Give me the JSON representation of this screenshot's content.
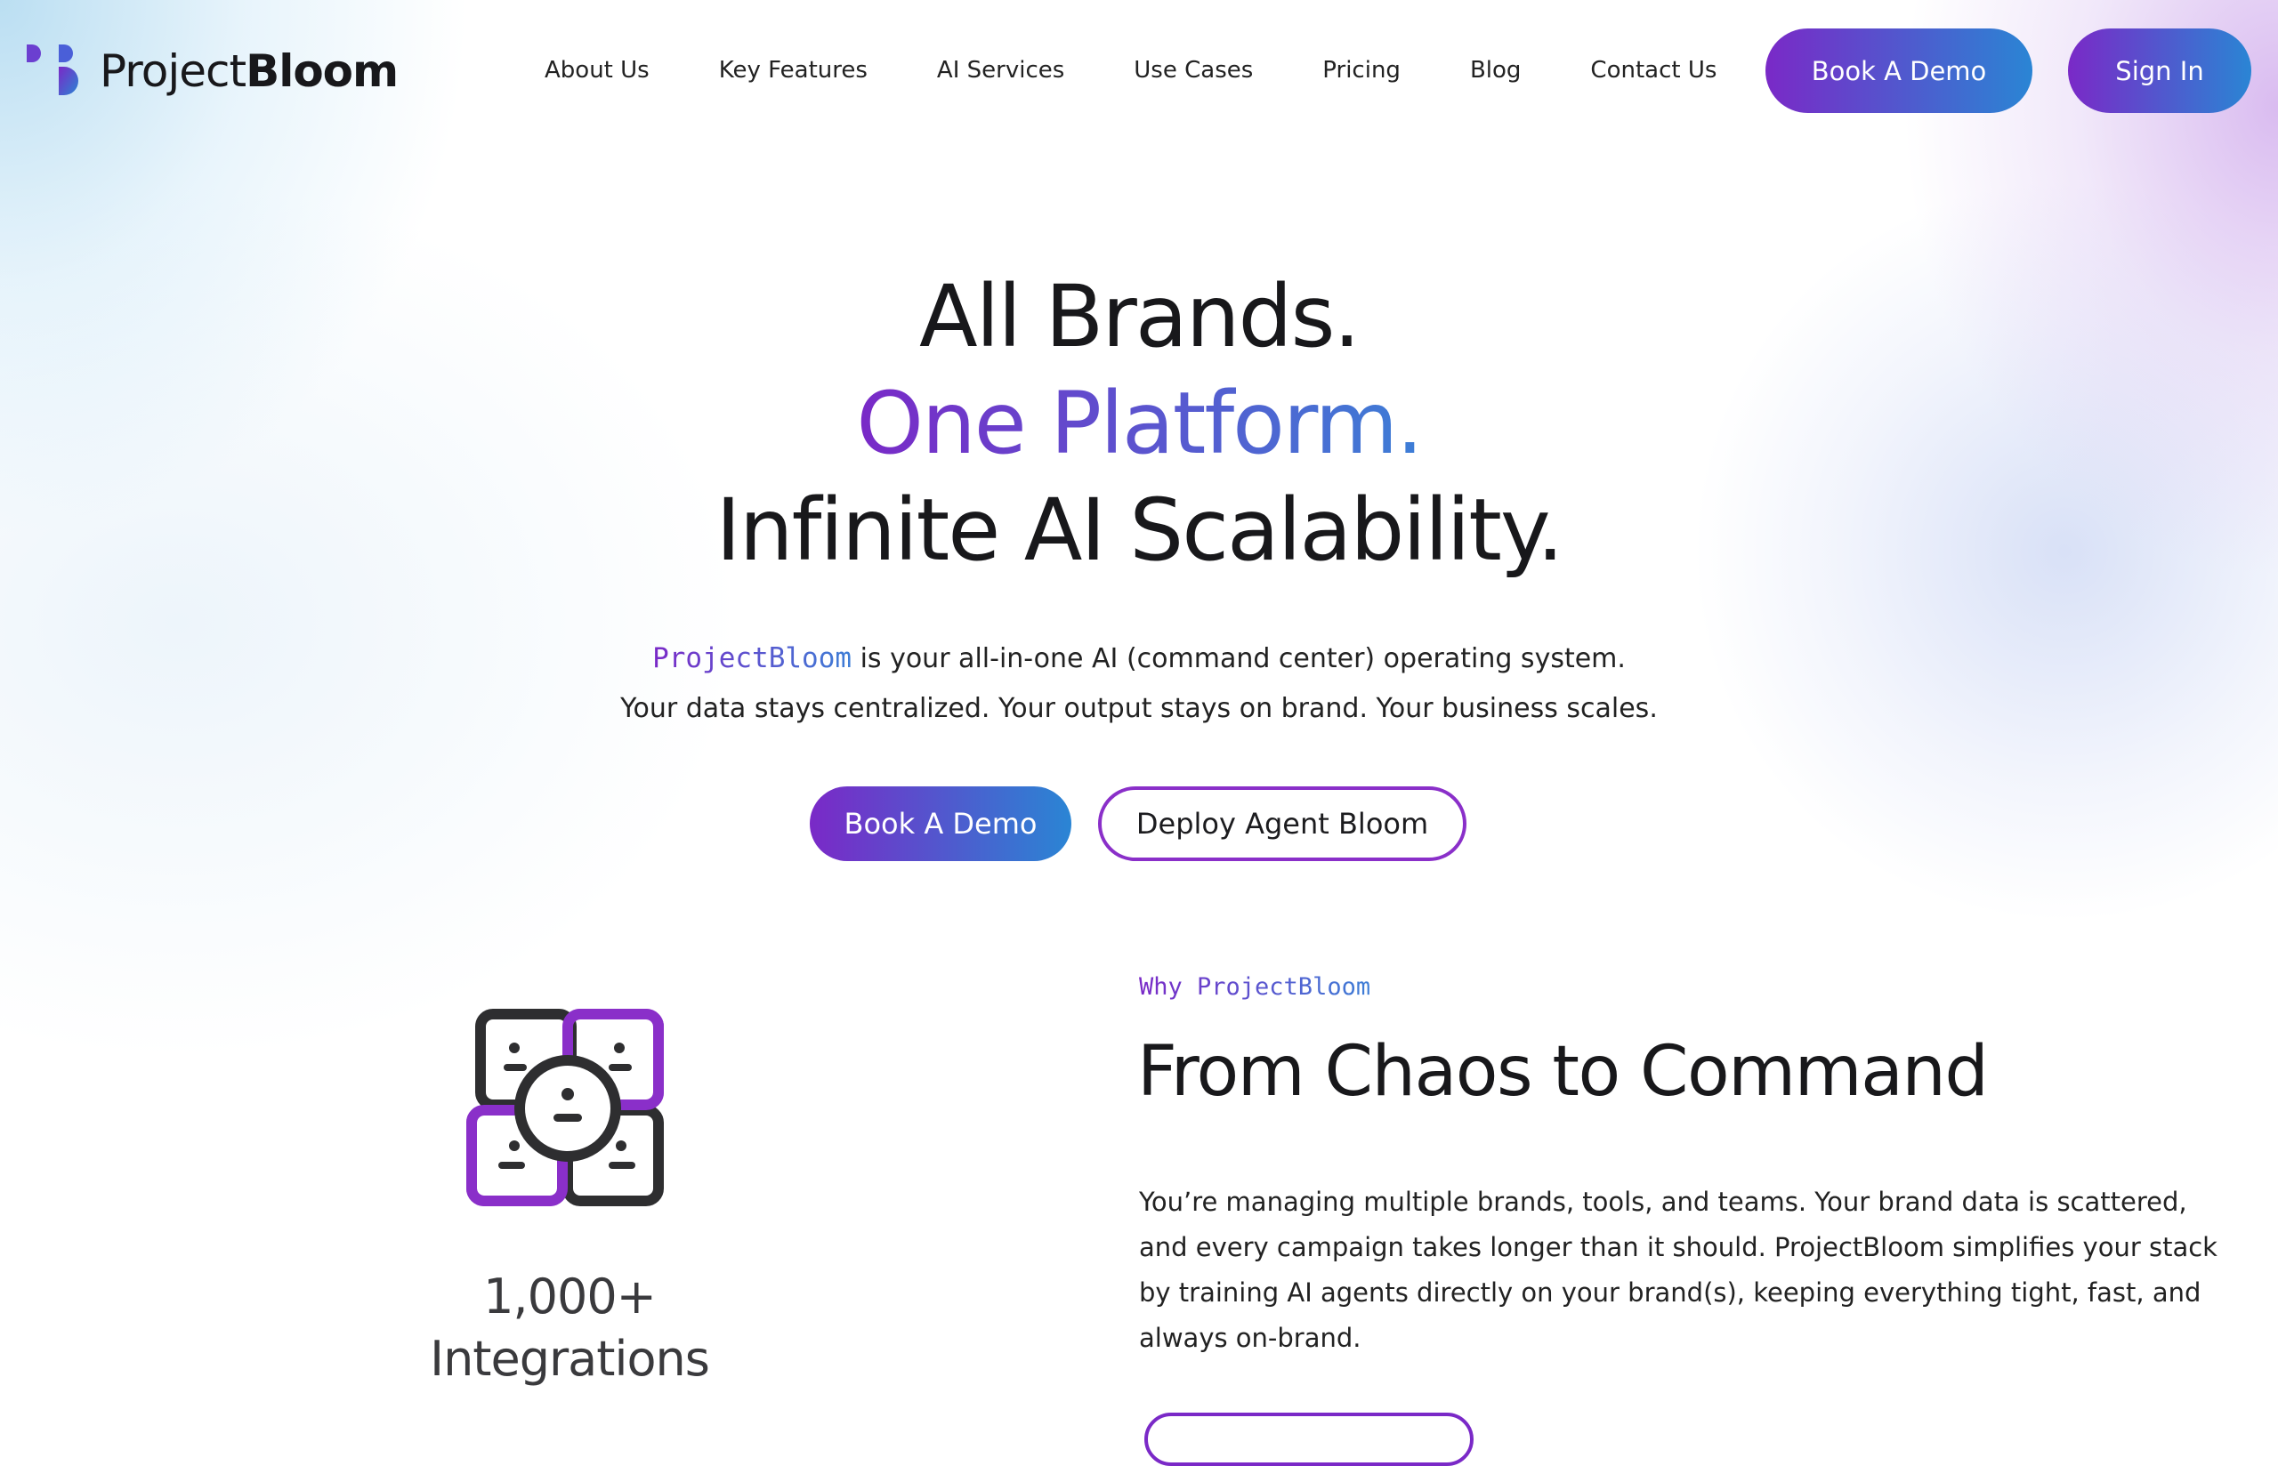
{
  "brand": {
    "name_light": "Project",
    "name_bold": "Bloom",
    "logo_icon": "bloom-logo-icon",
    "colors": {
      "gradient_start": "#7a29c7",
      "gradient_end": "#2a85d4",
      "text": "#18181b"
    }
  },
  "nav": {
    "links": [
      "About Us",
      "Key Features",
      "AI Services",
      "Use Cases",
      "Pricing",
      "Blog",
      "Contact Us"
    ],
    "book_demo": "Book A Demo",
    "sign_in": "Sign In"
  },
  "hero": {
    "line1": "All Brands.",
    "line2": "One Platform.",
    "line3": "Infinite AI Scalability.",
    "brand_mono": "ProjectBloom",
    "subtitle1_rest": " is your all-in-one AI (command center) operating system.",
    "subtitle2": "Your data stays centralized. Your output stays on brand. Your business scales.",
    "cta_primary": "Book A Demo",
    "cta_secondary": "Deploy Agent Bloom"
  },
  "integrations": {
    "icon": "integrations-faces-icon",
    "count": "1,000+",
    "label": "Integrations"
  },
  "why": {
    "eyebrow": "Why ProjectBloom",
    "title": "From Chaos to Command",
    "body": "You’re managing multiple brands, tools, and teams. Your brand data is scattered, and every campaign takes longer than it should. ProjectBloom simplifies your stack by training AI agents directly on your brand(s), keeping everything tight, fast, and always on-brand."
  }
}
